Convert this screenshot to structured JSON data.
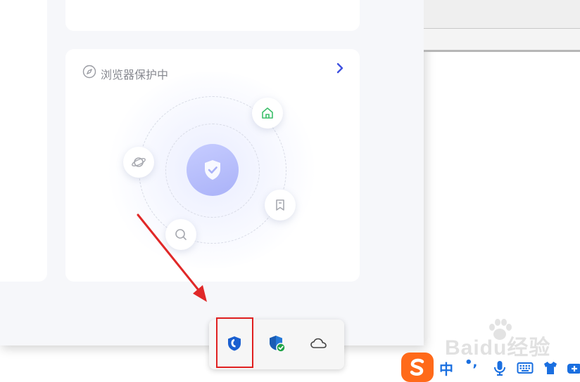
{
  "card": {
    "title": "浏览器保护中",
    "header_icon": "compass-icon",
    "chevron_icon": "chevron-right-icon"
  },
  "orbit": {
    "core_icon": "shield-check-icon",
    "satellites": [
      "home-icon",
      "bookmark-icon",
      "search-icon",
      "planet-icon"
    ]
  },
  "tray": {
    "icons": [
      "edge-security-icon",
      "windows-security-icon",
      "onedrive-cloud-icon"
    ]
  },
  "ime": {
    "mode_label": "中",
    "punct_label": "•,",
    "icons": [
      "sogou-ime-icon",
      "microphone-icon",
      "keyboard-icon",
      "skin-shirt-icon",
      "toolbox-icon"
    ]
  },
  "watermark": {
    "text": "Baidu经验"
  },
  "colors": {
    "accent": "#3f51e0",
    "core_gradient_start": "#c6ccff",
    "core_gradient_end": "#aab2f8",
    "highlight_red": "#e02020",
    "sogou_orange": "#ff6a1a"
  }
}
